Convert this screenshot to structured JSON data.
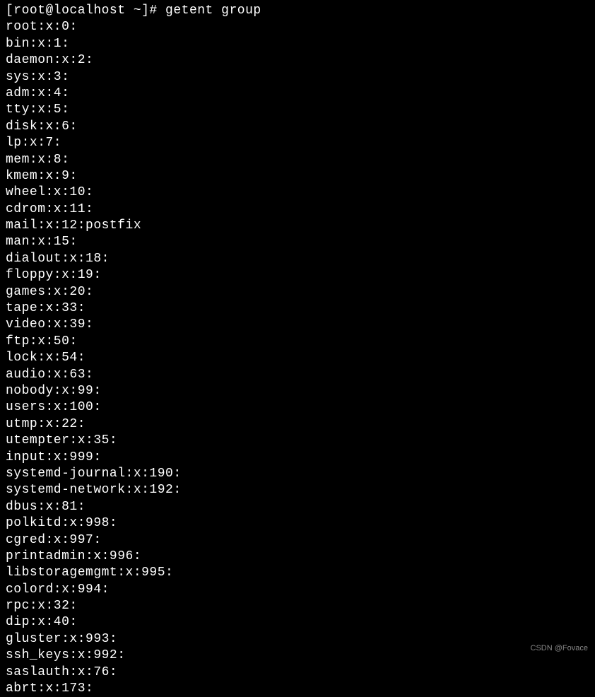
{
  "terminal": {
    "prompt": "[root@localhost ~]# ",
    "command": "getent group",
    "output": [
      "root:x:0:",
      "bin:x:1:",
      "daemon:x:2:",
      "sys:x:3:",
      "adm:x:4:",
      "tty:x:5:",
      "disk:x:6:",
      "lp:x:7:",
      "mem:x:8:",
      "kmem:x:9:",
      "wheel:x:10:",
      "cdrom:x:11:",
      "mail:x:12:postfix",
      "man:x:15:",
      "dialout:x:18:",
      "floppy:x:19:",
      "games:x:20:",
      "tape:x:33:",
      "video:x:39:",
      "ftp:x:50:",
      "lock:x:54:",
      "audio:x:63:",
      "nobody:x:99:",
      "users:x:100:",
      "utmp:x:22:",
      "utempter:x:35:",
      "input:x:999:",
      "systemd-journal:x:190:",
      "systemd-network:x:192:",
      "dbus:x:81:",
      "polkitd:x:998:",
      "cgred:x:997:",
      "printadmin:x:996:",
      "libstoragemgmt:x:995:",
      "colord:x:994:",
      "rpc:x:32:",
      "dip:x:40:",
      "gluster:x:993:",
      "ssh_keys:x:992:",
      "saslauth:x:76:",
      "abrt:x:173:"
    ]
  },
  "watermark": "CSDN @Fovace"
}
